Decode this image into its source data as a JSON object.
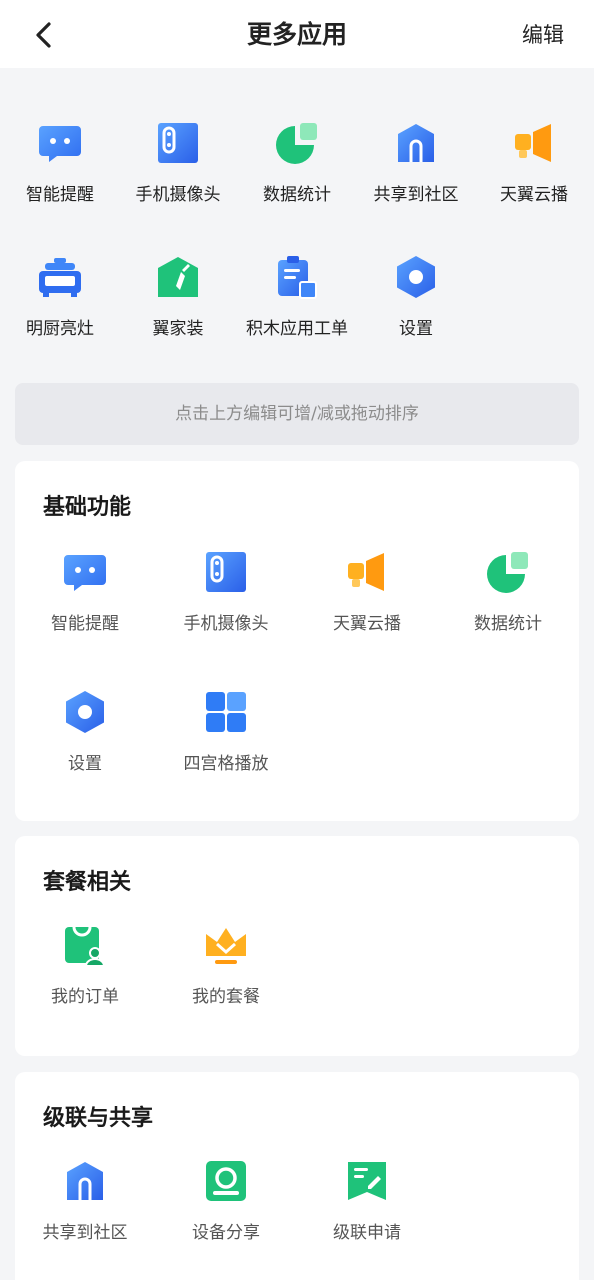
{
  "header": {
    "title": "更多应用",
    "edit_label": "编辑"
  },
  "pinned": [
    {
      "label": "智能提醒",
      "icon": "chat-bubble-icon"
    },
    {
      "label": "手机摄像头",
      "icon": "phone-camera-icon"
    },
    {
      "label": "数据统计",
      "icon": "pie-chart-icon"
    },
    {
      "label": "共享到社区",
      "icon": "community-share-icon"
    },
    {
      "label": "天翼云播",
      "icon": "broadcast-speaker-icon"
    },
    {
      "label": "明厨亮灶",
      "icon": "kitchen-stove-icon"
    },
    {
      "label": "翼家装",
      "icon": "home-decor-icon"
    },
    {
      "label": "积木应用工单",
      "icon": "work-order-icon"
    },
    {
      "label": "设置",
      "icon": "settings-hexagon-icon"
    }
  ],
  "hint": "点击上方编辑可增/减或拖动排序",
  "sections": [
    {
      "title": "基础功能",
      "items": [
        {
          "label": "智能提醒",
          "icon": "chat-bubble-icon"
        },
        {
          "label": "手机摄像头",
          "icon": "phone-camera-icon"
        },
        {
          "label": "天翼云播",
          "icon": "broadcast-speaker-icon"
        },
        {
          "label": "数据统计",
          "icon": "pie-chart-icon"
        },
        {
          "label": "设置",
          "icon": "settings-hexagon-icon"
        },
        {
          "label": "四宫格播放",
          "icon": "four-grid-icon"
        }
      ]
    },
    {
      "title": "套餐相关",
      "items": [
        {
          "label": "我的订单",
          "icon": "order-bag-icon"
        },
        {
          "label": "我的套餐",
          "icon": "crown-package-icon"
        }
      ]
    },
    {
      "title": "级联与共享",
      "items": [
        {
          "label": "共享到社区",
          "icon": "community-share-icon"
        },
        {
          "label": "设备分享",
          "icon": "device-share-icon"
        },
        {
          "label": "级联申请",
          "icon": "cascade-apply-icon"
        }
      ]
    }
  ],
  "colors": {
    "blue": "#2f7cf6",
    "green": "#1fc27a",
    "orange": "#ff9f1a",
    "background": "#f4f5f7"
  }
}
